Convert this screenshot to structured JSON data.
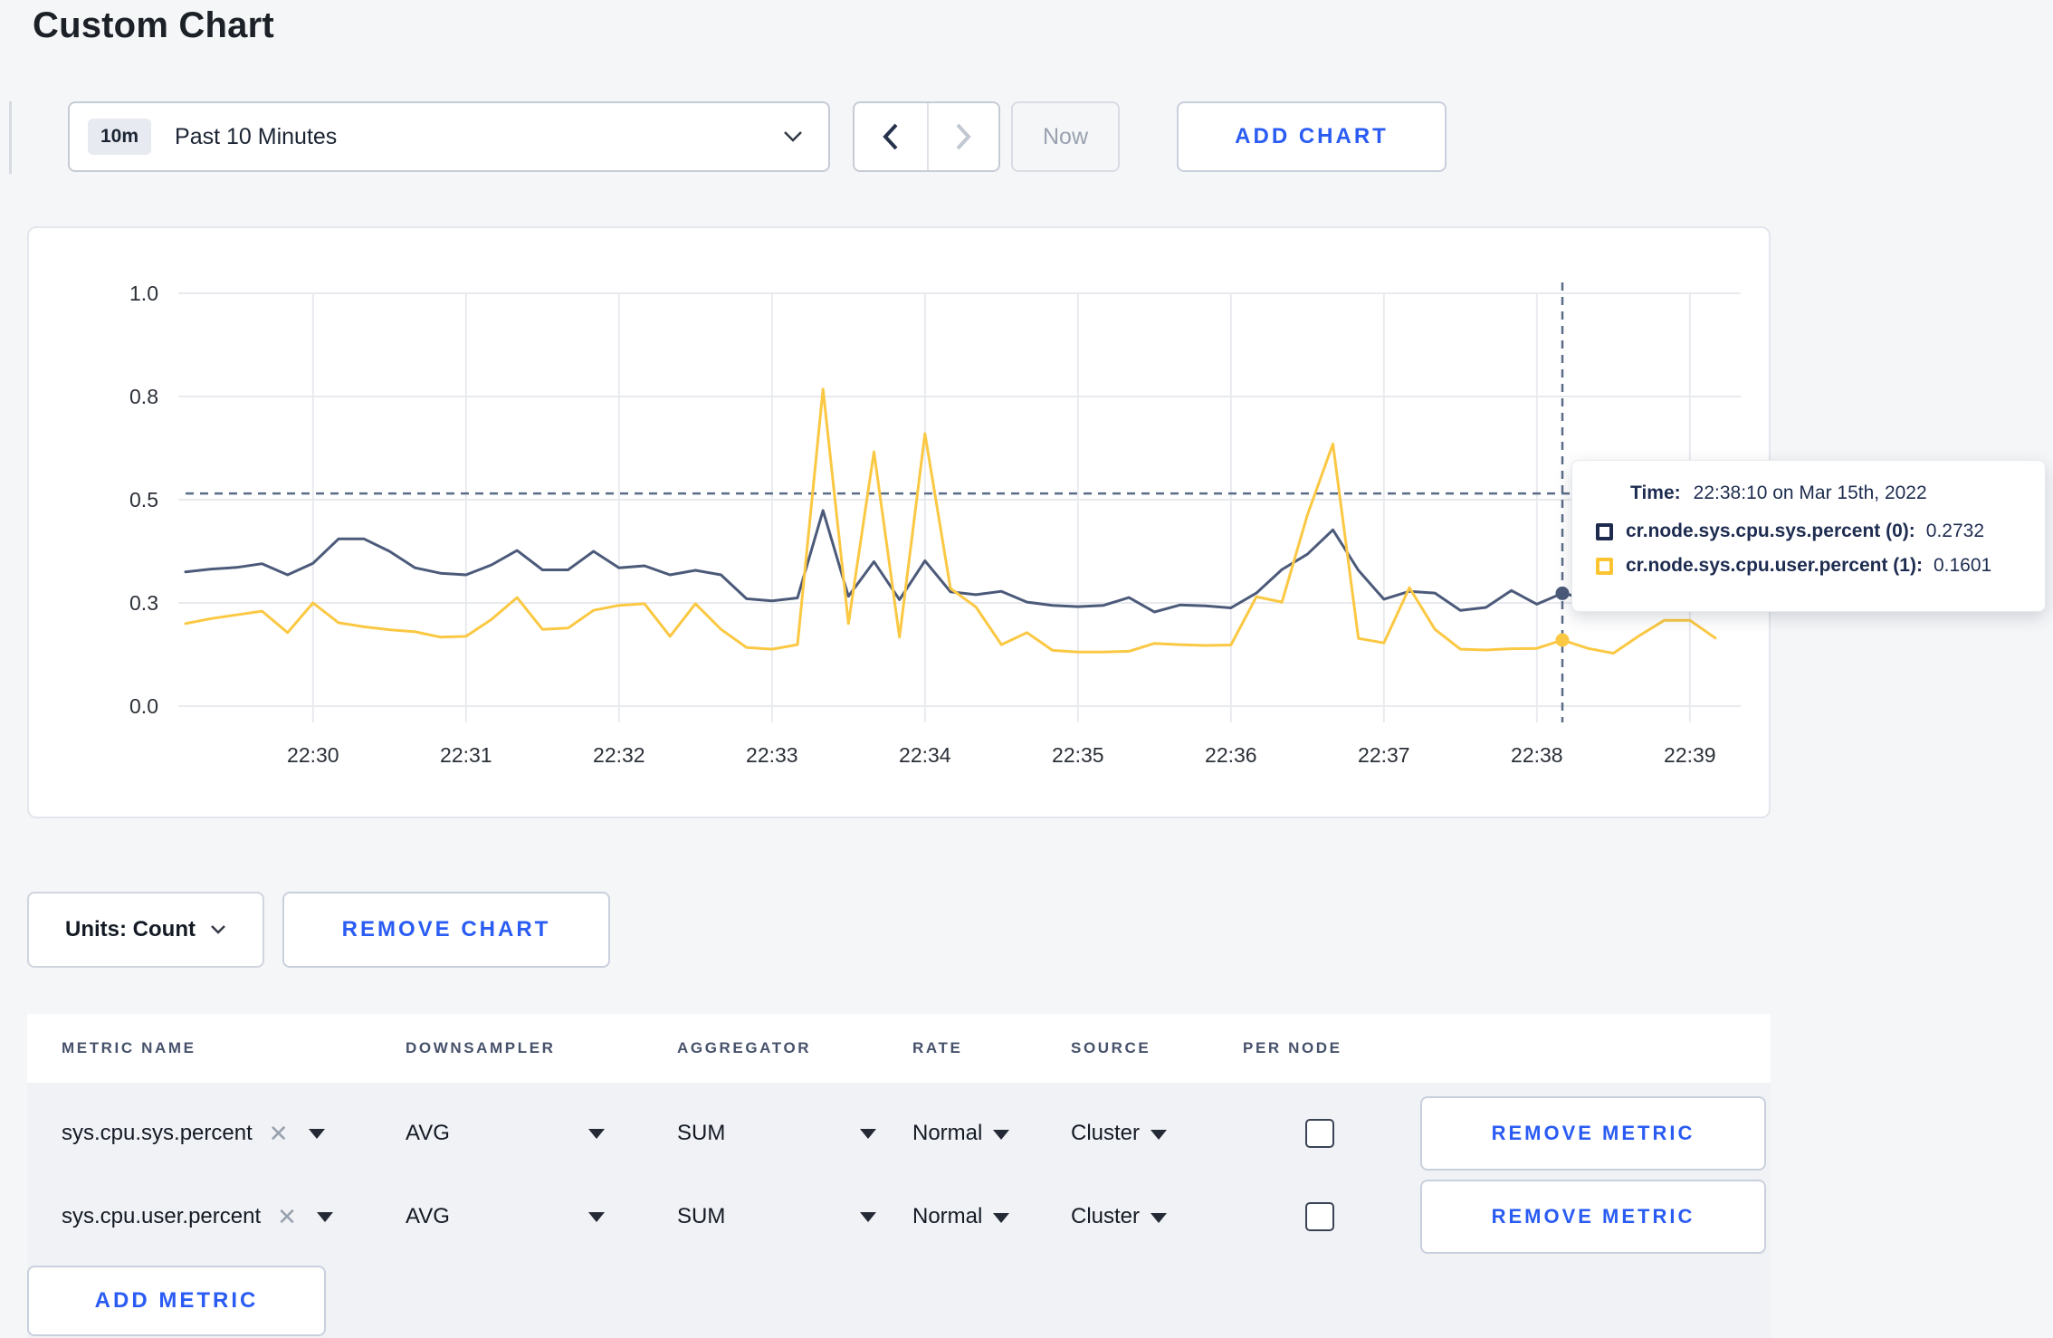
{
  "page": {
    "title": "Custom Chart"
  },
  "toolbar": {
    "time_badge": "10m",
    "time_range_label": "Past 10 Minutes",
    "prev_icon": "chevron-left",
    "next_icon": "chevron-right",
    "now_label": "Now",
    "add_chart_label": "ADD CHART"
  },
  "accent_colors": {
    "link_blue": "#2a5cf4",
    "sys_line": "#4c5a7a",
    "user_line": "#fbc843",
    "sys_legend": "#1e2b4d",
    "user_legend": "#fdc431",
    "crosshair": "#5a6c87",
    "gridline": "#e8eaee"
  },
  "tooltip": {
    "time_label": "Time:",
    "time_value": "22:38:10 on Mar 15th, 2022",
    "series": [
      {
        "label": "cr.node.sys.cpu.sys.percent (0):",
        "value": "0.2732"
      },
      {
        "label": "cr.node.sys.cpu.user.percent (1):",
        "value": "0.1601"
      }
    ]
  },
  "units_row": {
    "units_label": "Units: Count",
    "remove_chart_label": "REMOVE CHART"
  },
  "metrics_table": {
    "headers": [
      "METRIC NAME",
      "DOWNSAMPLER",
      "AGGREGATOR",
      "RATE",
      "SOURCE",
      "PER NODE"
    ],
    "rows": [
      {
        "name": "sys.cpu.sys.percent",
        "downsampler": "AVG",
        "aggregator": "SUM",
        "rate": "Normal",
        "source": "Cluster",
        "per_node_checked": false,
        "remove_label": "REMOVE METRIC"
      },
      {
        "name": "sys.cpu.user.percent",
        "downsampler": "AVG",
        "aggregator": "SUM",
        "rate": "Normal",
        "source": "Cluster",
        "per_node_checked": false,
        "remove_label": "REMOVE METRIC"
      }
    ],
    "add_metric_label": "ADD METRIC"
  },
  "chart_data": {
    "type": "line",
    "title": "",
    "xlabel": "",
    "ylabel": "",
    "x_start": "22:29:10",
    "x_step_seconds": 10,
    "x_ticks": [
      "22:30",
      "22:31",
      "22:32",
      "22:33",
      "22:34",
      "22:35",
      "22:36",
      "22:37",
      "22:38",
      "22:39"
    ],
    "y_ticks": [
      {
        "value": 0.0,
        "label": "0.0"
      },
      {
        "value": 0.25,
        "label": "0.3"
      },
      {
        "value": 0.5,
        "label": "0.5"
      },
      {
        "value": 0.75,
        "label": "0.8"
      },
      {
        "value": 1.0,
        "label": "1.0"
      }
    ],
    "y_domain": [
      0,
      1
    ],
    "grid": true,
    "legend_position": "tooltip",
    "series": [
      {
        "name": "cr.node.sys.cpu.sys.percent",
        "color": "#4c5a7a",
        "legend_color": "#1e2b4d",
        "values": [
          0.325,
          0.332,
          0.336,
          0.345,
          0.318,
          0.346,
          0.405,
          0.405,
          0.375,
          0.335,
          0.322,
          0.318,
          0.342,
          0.377,
          0.33,
          0.33,
          0.375,
          0.335,
          0.34,
          0.318,
          0.329,
          0.318,
          0.26,
          0.255,
          0.262,
          0.474,
          0.266,
          0.35,
          0.258,
          0.352,
          0.277,
          0.27,
          0.278,
          0.252,
          0.244,
          0.241,
          0.244,
          0.263,
          0.228,
          0.245,
          0.243,
          0.238,
          0.274,
          0.331,
          0.368,
          0.427,
          0.329,
          0.259,
          0.278,
          0.274,
          0.232,
          0.239,
          0.28,
          0.247,
          0.2732,
          0.26,
          0.285,
          0.3,
          0.295,
          0.3,
          0.305
        ]
      },
      {
        "name": "cr.node.sys.cpu.user.percent",
        "color": "#fbc843",
        "legend_color": "#fdc431",
        "values": [
          0.2,
          0.212,
          0.221,
          0.23,
          0.178,
          0.25,
          0.202,
          0.192,
          0.185,
          0.18,
          0.167,
          0.169,
          0.21,
          0.263,
          0.186,
          0.189,
          0.232,
          0.244,
          0.248,
          0.169,
          0.248,
          0.186,
          0.142,
          0.138,
          0.149,
          0.768,
          0.2,
          0.616,
          0.167,
          0.66,
          0.285,
          0.24,
          0.149,
          0.178,
          0.135,
          0.131,
          0.131,
          0.133,
          0.152,
          0.149,
          0.147,
          0.148,
          0.265,
          0.252,
          0.463,
          0.635,
          0.164,
          0.153,
          0.287,
          0.186,
          0.138,
          0.136,
          0.139,
          0.14,
          0.1601,
          0.14,
          0.128,
          0.17,
          0.208,
          0.208,
          0.165
        ]
      }
    ],
    "crosshair": {
      "time_index": 54,
      "time_label": "22:38:10",
      "h_value": 0.515
    }
  }
}
